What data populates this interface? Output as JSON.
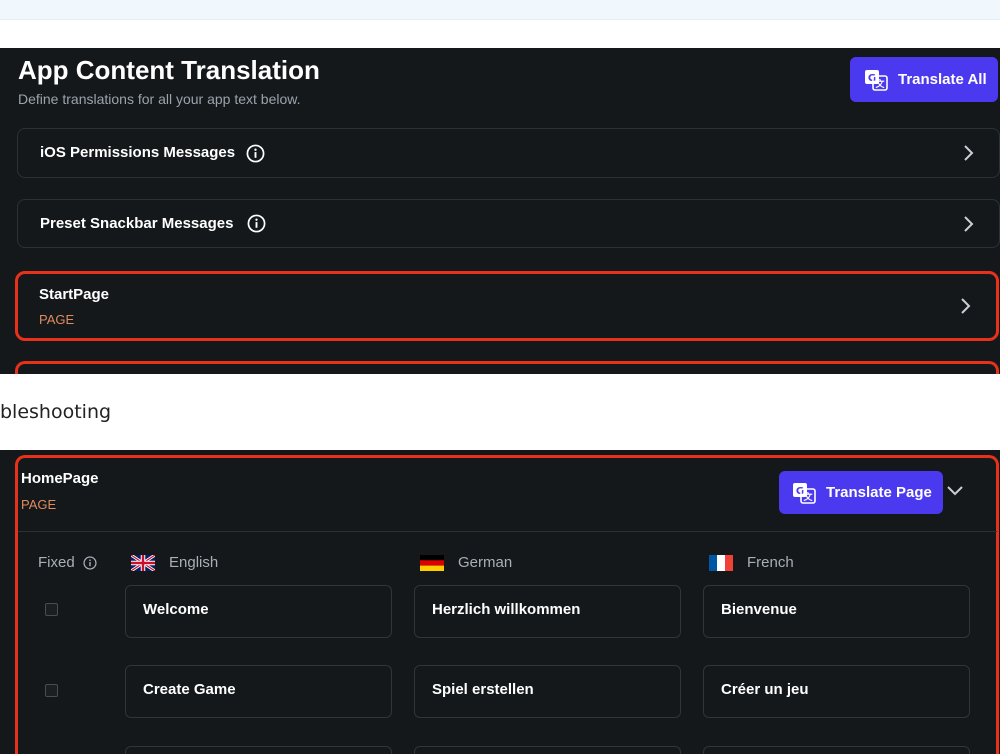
{
  "header": {
    "title": "App Content Translation",
    "subtitle": "Define translations for all your app text below.",
    "translate_all_label": "Translate All"
  },
  "sections": {
    "ios_permissions": {
      "label": "iOS Permissions Messages"
    },
    "preset_snackbar": {
      "label": "Preset Snackbar Messages"
    },
    "start_page": {
      "label": "StartPage",
      "type": "PAGE"
    }
  },
  "overlay_text": "bleshooting",
  "home_page": {
    "label": "HomePage",
    "type": "PAGE",
    "translate_page_label": "Translate Page",
    "columns": {
      "fixed": "Fixed",
      "english": "English",
      "german": "German",
      "french": "French"
    },
    "rows": [
      {
        "fixed": false,
        "english": "Welcome",
        "german": "Herzlich willkommen",
        "french": "Bienvenue"
      },
      {
        "fixed": false,
        "english": "Create Game",
        "german": "Spiel erstellen",
        "french": "Créer un jeu"
      }
    ]
  },
  "colors": {
    "background": "#14181b",
    "primary": "#4b39ef",
    "page_badge": "#e08a5e",
    "highlight": "#e8311a"
  },
  "icons": [
    "translate-icon",
    "info-icon",
    "chevron-right-icon",
    "chevron-down-icon",
    "flag-uk-icon",
    "flag-germany-icon",
    "flag-france-icon"
  ]
}
